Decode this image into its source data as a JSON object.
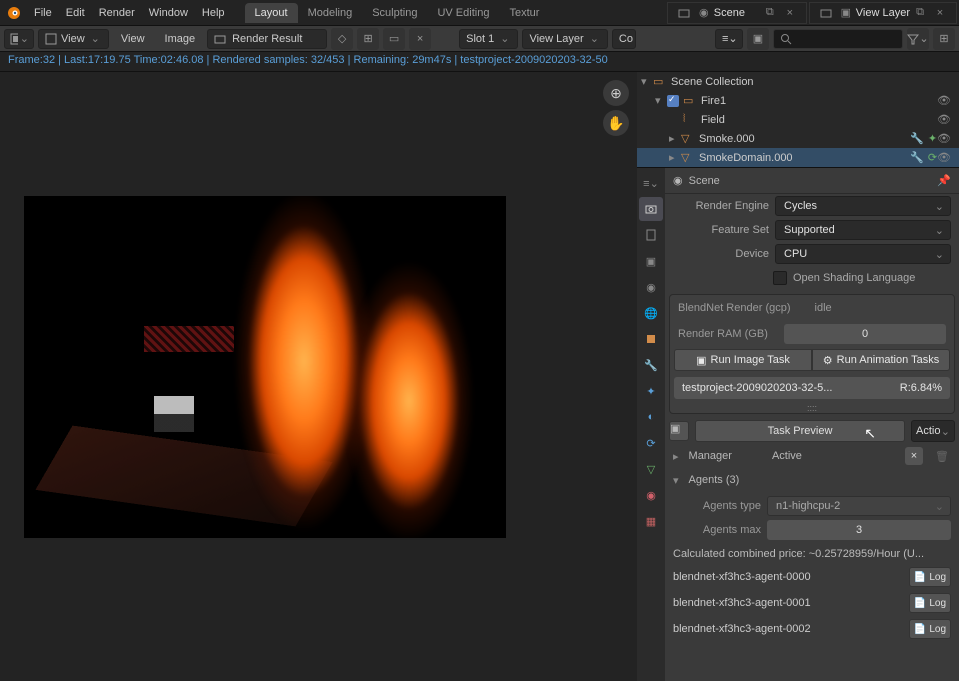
{
  "topbar": {
    "menus": [
      "File",
      "Edit",
      "Render",
      "Window",
      "Help"
    ],
    "tabs": [
      "Layout",
      "Modeling",
      "Sculpting",
      "UV Editing",
      "Textur"
    ],
    "activeTab": 0,
    "scene": "Scene",
    "viewLayer": "View Layer"
  },
  "toolbar": {
    "view": "View",
    "view2": "View",
    "image": "Image",
    "renderResult": "Render Result",
    "slot": "Slot 1",
    "viewLayer": "View Layer",
    "combined": "Co"
  },
  "status": "Frame:32 | Last:17:19.75 Time:02:46.08 | Rendered samples: 32/453 | Remaining: 29m47s | testproject-2009020203-32-50",
  "outliner": {
    "root": "Scene Collection",
    "items": [
      {
        "name": "Fire1",
        "indent": 1,
        "icon": "collection",
        "checked": true,
        "tri": "▾",
        "vis": true
      },
      {
        "name": "Field",
        "indent": 2,
        "icon": "field",
        "color": "#d28c4a",
        "vis": true
      },
      {
        "name": "Smoke.000",
        "indent": 2,
        "icon": "mesh",
        "tri": "▸",
        "tools": true,
        "vis": true
      },
      {
        "name": "SmokeDomain.000",
        "indent": 2,
        "icon": "mesh",
        "tri": "▸",
        "tools": true,
        "vis": true,
        "sel": true
      }
    ]
  },
  "props": {
    "header": "Scene",
    "renderEngine": {
      "label": "Render Engine",
      "value": "Cycles"
    },
    "featureSet": {
      "label": "Feature Set",
      "value": "Supported"
    },
    "device": {
      "label": "Device",
      "value": "CPU"
    },
    "osl": "Open Shading Language",
    "blendnet": {
      "title": "BlendNet Render (gcp)",
      "status": "idle",
      "ramLabel": "Render RAM (GB)",
      "ramValue": "0",
      "runImage": "Run Image Task",
      "runAnim": "Run Animation Tasks",
      "taskName": "testproject-2009020203-32-5...",
      "taskProgress": "R:6.84%",
      "taskPreview": "Task Preview",
      "action": "Actio"
    },
    "manager": {
      "label": "Manager",
      "status": "Active"
    },
    "agents": {
      "title": "Agents (3)",
      "typeLabel": "Agents type",
      "typeValue": "n1-highcpu-2",
      "maxLabel": "Agents max",
      "maxValue": "3",
      "calc": "Calculated combined price: ~0.25728959/Hour (U...",
      "items": [
        "blendnet-xf3hc3-agent-0000",
        "blendnet-xf3hc3-agent-0001",
        "blendnet-xf3hc3-agent-0002"
      ],
      "log": "Log"
    }
  }
}
